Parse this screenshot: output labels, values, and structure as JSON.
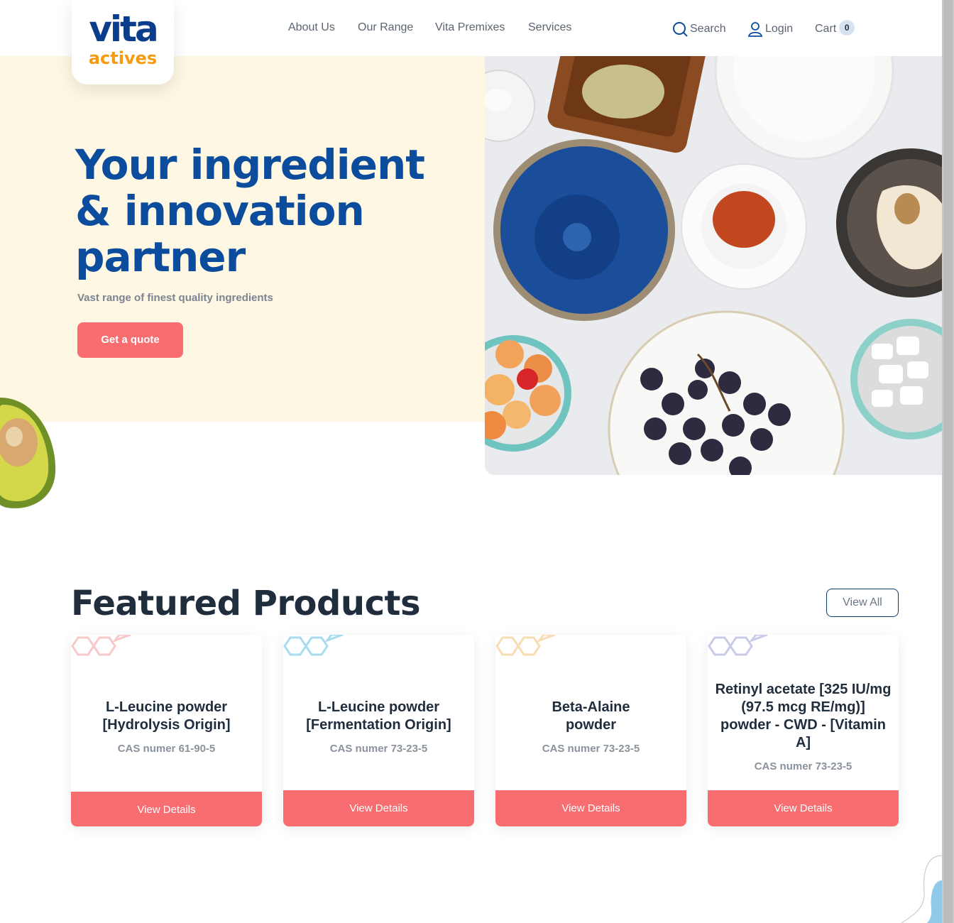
{
  "brand": {
    "logo_top": "vita",
    "logo_bottom": "actives"
  },
  "nav": {
    "items": [
      "About Us",
      "Our Range",
      "Vita Premixes",
      "Services"
    ],
    "search_label": "Search",
    "login_label": "Login",
    "cart_label": "Cart",
    "cart_count": "0"
  },
  "hero": {
    "title": "Your ingredient & innovation partner",
    "subtitle": "Vast range of finest quality ingredients",
    "cta_label": "Get a quote"
  },
  "featured": {
    "title": "Featured Products",
    "view_all_label": "View All",
    "products": [
      {
        "name": "L-Leucine powder [Hydrolysis Origin]",
        "cas": "CAS numer 61-90-5",
        "button": "View Details",
        "hex_color": "#f7c9c9"
      },
      {
        "name": "L-Leucine powder [Fermentation Origin]",
        "cas": "CAS numer 73-23-5",
        "button": "View Details",
        "hex_color": "#a9dcef"
      },
      {
        "name": "Beta-Alaine powder",
        "cas": "CAS numer 73-23-5",
        "button": "View Details",
        "hex_color": "#f8dcb4"
      },
      {
        "name": "Retinyl acetate [325 IU/mg (97.5 mcg RE/mg)] powder - CWD - [Vitamin A]",
        "cas": "CAS numer 73-23-5",
        "button": "View Details",
        "hex_color": "#c9cbe8"
      }
    ]
  },
  "colors": {
    "primary_blue": "#0b4c9c",
    "accent_coral": "#f86d70",
    "logo_orange": "#f49b11",
    "hero_cream": "#fdf7e3"
  }
}
